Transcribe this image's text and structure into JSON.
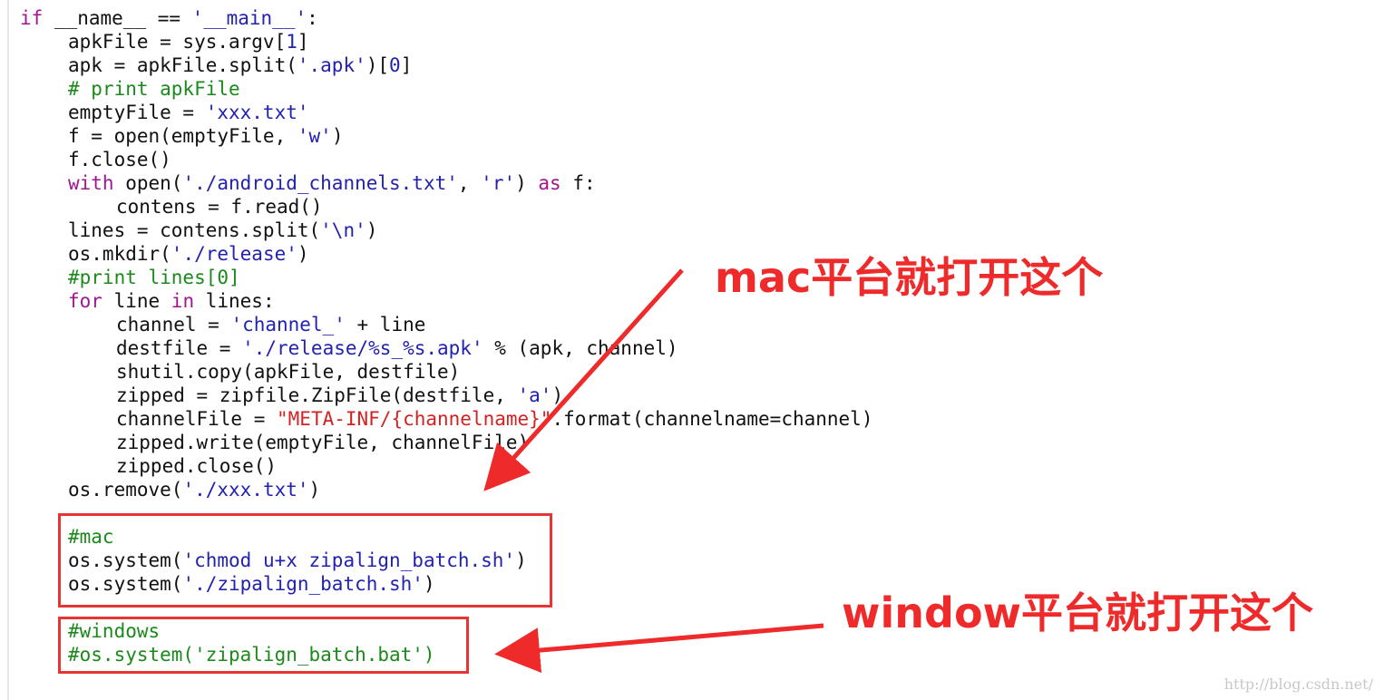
{
  "code_lines": [
    {
      "indent": 0,
      "tokens": [
        {
          "t": "kw",
          "v": "if"
        },
        {
          "t": "plain",
          "v": " __name__ == "
        },
        {
          "t": "str",
          "v": "'__main__'"
        },
        {
          "t": "plain",
          "v": ":"
        }
      ]
    },
    {
      "indent": 1,
      "tokens": [
        {
          "t": "plain",
          "v": "apkFile = sys.argv["
        },
        {
          "t": "num",
          "v": "1"
        },
        {
          "t": "plain",
          "v": "]"
        }
      ]
    },
    {
      "indent": 1,
      "tokens": [
        {
          "t": "plain",
          "v": "apk = apkFile.split("
        },
        {
          "t": "str",
          "v": "'.apk'"
        },
        {
          "t": "plain",
          "v": ")["
        },
        {
          "t": "num",
          "v": "0"
        },
        {
          "t": "plain",
          "v": "]"
        }
      ]
    },
    {
      "indent": 1,
      "tokens": [
        {
          "t": "com",
          "v": "# print apkFile"
        }
      ]
    },
    {
      "indent": 1,
      "tokens": [
        {
          "t": "plain",
          "v": "emptyFile = "
        },
        {
          "t": "str",
          "v": "'xxx.txt'"
        }
      ]
    },
    {
      "indent": 1,
      "tokens": [
        {
          "t": "plain",
          "v": "f = open(emptyFile, "
        },
        {
          "t": "str",
          "v": "'w'"
        },
        {
          "t": "plain",
          "v": ")"
        }
      ]
    },
    {
      "indent": 1,
      "tokens": [
        {
          "t": "plain",
          "v": "f.close()"
        }
      ]
    },
    {
      "indent": 1,
      "tokens": [
        {
          "t": "kw",
          "v": "with"
        },
        {
          "t": "plain",
          "v": " open("
        },
        {
          "t": "str",
          "v": "'./android_channels.txt'"
        },
        {
          "t": "plain",
          "v": ", "
        },
        {
          "t": "str",
          "v": "'r'"
        },
        {
          "t": "plain",
          "v": ") "
        },
        {
          "t": "kw",
          "v": "as"
        },
        {
          "t": "plain",
          "v": " f:"
        }
      ]
    },
    {
      "indent": 2,
      "tokens": [
        {
          "t": "plain",
          "v": "contens = f.read()"
        }
      ]
    },
    {
      "indent": 1,
      "tokens": [
        {
          "t": "plain",
          "v": "lines = contens.split("
        },
        {
          "t": "str",
          "v": "'\\n'"
        },
        {
          "t": "plain",
          "v": ")"
        }
      ]
    },
    {
      "indent": 1,
      "tokens": [
        {
          "t": "plain",
          "v": "os.mkdir("
        },
        {
          "t": "str",
          "v": "'./release'"
        },
        {
          "t": "plain",
          "v": ")"
        }
      ]
    },
    {
      "indent": 1,
      "tokens": [
        {
          "t": "com",
          "v": "#print lines[0]"
        }
      ]
    },
    {
      "indent": 1,
      "tokens": [
        {
          "t": "kw",
          "v": "for"
        },
        {
          "t": "plain",
          "v": " line "
        },
        {
          "t": "kw",
          "v": "in"
        },
        {
          "t": "plain",
          "v": " lines:"
        }
      ]
    },
    {
      "indent": 2,
      "tokens": [
        {
          "t": "plain",
          "v": "channel = "
        },
        {
          "t": "str",
          "v": "'channel_'"
        },
        {
          "t": "plain",
          "v": " + line"
        }
      ]
    },
    {
      "indent": 2,
      "tokens": [
        {
          "t": "plain",
          "v": "destfile = "
        },
        {
          "t": "str",
          "v": "'./release/%s_%s.apk'"
        },
        {
          "t": "plain",
          "v": " % (apk, channel)"
        }
      ]
    },
    {
      "indent": 2,
      "tokens": [
        {
          "t": "plain",
          "v": "shutil.copy(apkFile, destfile)"
        }
      ]
    },
    {
      "indent": 2,
      "tokens": [
        {
          "t": "plain",
          "v": "zipped = zipfile.ZipFile(destfile, "
        },
        {
          "t": "str",
          "v": "'a'"
        },
        {
          "t": "plain",
          "v": ")"
        }
      ]
    },
    {
      "indent": 2,
      "tokens": [
        {
          "t": "plain",
          "v": "channelFile = "
        },
        {
          "t": "dstr",
          "v": "\"META-INF/{channelname}\""
        },
        {
          "t": "plain",
          "v": ".format(channelname=channel)"
        }
      ]
    },
    {
      "indent": 2,
      "tokens": [
        {
          "t": "plain",
          "v": "zipped.write(emptyFile, channelFile)"
        }
      ]
    },
    {
      "indent": 2,
      "tokens": [
        {
          "t": "plain",
          "v": "zipped.close()"
        }
      ]
    },
    {
      "indent": 1,
      "tokens": [
        {
          "t": "plain",
          "v": "os.remove("
        },
        {
          "t": "str",
          "v": "'./xxx.txt'"
        },
        {
          "t": "plain",
          "v": ")"
        }
      ]
    },
    {
      "indent": 1,
      "tokens": []
    },
    {
      "indent": 1,
      "tokens": [
        {
          "t": "com",
          "v": "#mac"
        }
      ]
    },
    {
      "indent": 1,
      "tokens": [
        {
          "t": "plain",
          "v": "os.system("
        },
        {
          "t": "str",
          "v": "'chmod u+x zipalign_batch.sh'"
        },
        {
          "t": "plain",
          "v": ")"
        }
      ]
    },
    {
      "indent": 1,
      "tokens": [
        {
          "t": "plain",
          "v": "os.system("
        },
        {
          "t": "str",
          "v": "'./zipalign_batch.sh'"
        },
        {
          "t": "plain",
          "v": ")"
        }
      ]
    },
    {
      "indent": 1,
      "tokens": []
    },
    {
      "indent": 1,
      "tokens": [
        {
          "t": "com",
          "v": "#windows"
        }
      ]
    },
    {
      "indent": 1,
      "tokens": [
        {
          "t": "com",
          "v": "#os.system('zipalign_batch.bat')"
        }
      ]
    }
  ],
  "annotations": {
    "mac_label": "mac平台就打开这个",
    "windows_label": "window平台就打开这个"
  },
  "watermark": "http://blog.csdn.net/",
  "colors": {
    "keyword": "#a3158f",
    "string": "#2222b0",
    "double_string": "#d42222",
    "comment": "#1a8a1a",
    "annotation": "#ee2a2a"
  }
}
